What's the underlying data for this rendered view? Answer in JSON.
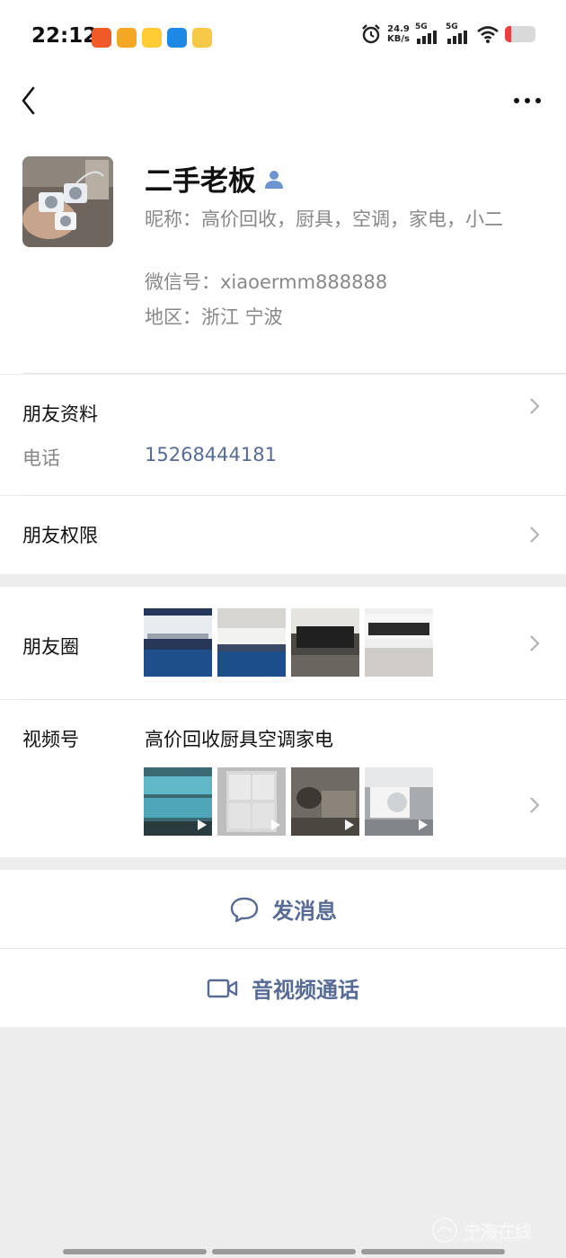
{
  "status_bar": {
    "time": "22:12",
    "net_speed_value": "24.9",
    "net_speed_unit": "KB/s",
    "sim1_label": "5G",
    "sim2_label": "5G",
    "app_icon_colors": [
      "#f05a28",
      "#f5a623",
      "#ffcc33",
      "#1e88e5",
      "#f7c948"
    ]
  },
  "profile": {
    "name": "二手老板",
    "nickname": "昵称：高价回收，厨具，空调，家电，小二",
    "wechat_id": "微信号：xiaoermm888888",
    "region": "地区：浙江  宁波"
  },
  "friend_info": {
    "title": "朋友资料",
    "phone_label": "电话",
    "phone_value": "15268444181"
  },
  "permissions": {
    "title": "朋友权限"
  },
  "moments": {
    "title": "朋友圈",
    "thumbnails": [
      "ac-unit-photo-1",
      "ac-unit-photo-2",
      "ac-unit-photo-3",
      "ac-unit-photo-4"
    ]
  },
  "channels": {
    "title": "视频号",
    "channel_name": "高价回收厨具空调家电",
    "videos": [
      "kitchen-video-1",
      "fridge-video-2",
      "storage-video-3",
      "ac-outdoor-video-4"
    ]
  },
  "actions": {
    "message_label": "发消息",
    "call_label": "音视频通话"
  },
  "watermark": {
    "text": "宁海在线",
    "url": "www.nhzj.com"
  },
  "colors": {
    "link": "#576b95",
    "background": "#ededed"
  }
}
